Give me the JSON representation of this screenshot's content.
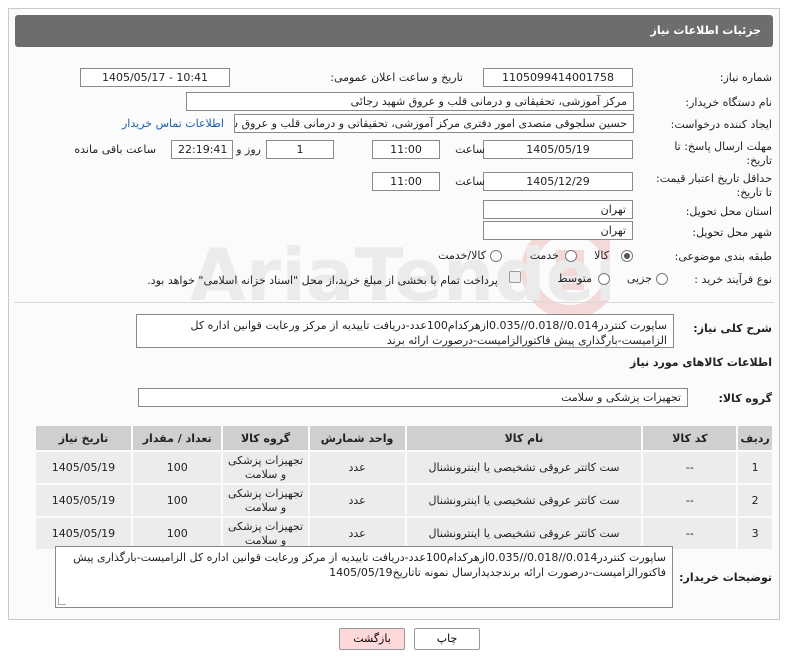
{
  "header": {
    "title": "جزئیات اطلاعات نیاز"
  },
  "form": {
    "need_number_label": "شماره نیاز:",
    "need_number": "1105099414001758",
    "announce_label": "تاریخ و ساعت اعلان عمومی:",
    "announce_value": "1405/05/17 - 10:41",
    "buyer_org_label": "نام دستگاه خریدار:",
    "buyer_org": "مرکز آموزشی، تحقیقاتی و درمانی قلب و عروق شهید رجائی",
    "creator_label": "ایجاد کننده درخواست:",
    "creator": "حسین سلجوقی متصدی امور دفتری مرکز آموزشی، تحقیقاتی و درمانی قلب و عروق شهید رجائی",
    "contact_link": "اطلاعات تماس خریدار",
    "deadline_label": "مهلت ارسال پاسخ: تا تاریخ:",
    "deadline_date": "1405/05/19",
    "time_label": "ساعت",
    "deadline_time": "11:00",
    "days_value": "1",
    "days_label": "روز و",
    "remaining_time": "22:19:41",
    "remaining_label": "ساعت باقی مانده",
    "validity_label": "حداقل تاریخ اعتبار قیمت: تا تاریخ:",
    "validity_date": "1405/12/29",
    "validity_time": "11:00",
    "province_label": "استان محل تحویل:",
    "province": "تهران",
    "city_label": "شهر محل تحویل:",
    "city": "تهران",
    "category_label": "طبقه بندی موضوعی:",
    "category_options": [
      "کالا",
      "خدمت",
      "کالا/خدمت"
    ],
    "purchase_type_label": "نوع فرآیند خرید :",
    "purchase_options": [
      "جزیی",
      "متوسط"
    ],
    "payment_note": "پرداخت تمام یا بخشی از مبلغ خرید،از محل \"اسناد خزانه اسلامی\" خواهد بود.",
    "summary_label": "شرح کلی نیاز:",
    "summary": "ساپورت کنتردر0.014//0.018//0.035ازهرکدام100عدد-دریافت تاییدیه از مرکز ورعایت قوانین اداره کل الزامیست-بارگذاری پیش فاکتورالزامیست-درصورت ارائه برند",
    "goods_info_label": "اطلاعات کالاهای مورد نیاز",
    "goods_group_label": "گروه کالا:",
    "goods_group": "تجهیزات پزشکی و سلامت"
  },
  "table": {
    "headers": [
      "ردیف",
      "کد کالا",
      "نام کالا",
      "واحد شمارش",
      "گروه کالا",
      "تعداد / مقدار",
      "تاریخ نیاز"
    ],
    "rows": [
      {
        "idx": "1",
        "code": "--",
        "name": "ست کاتتر عروقی تشخیصی یا اینترونشنال",
        "unit": "عدد",
        "group": "تجهیزات پزشکی و سلامت",
        "qty": "100",
        "date": "1405/05/19"
      },
      {
        "idx": "2",
        "code": "--",
        "name": "ست کاتتر عروقی تشخیصی یا اینترونشنال",
        "unit": "عدد",
        "group": "تجهیزات پزشکی و سلامت",
        "qty": "100",
        "date": "1405/05/19"
      },
      {
        "idx": "3",
        "code": "--",
        "name": "ست کاتتر عروقی تشخیصی یا اینترونشنال",
        "unit": "عدد",
        "group": "تجهیزات پزشکی و سلامت",
        "qty": "100",
        "date": "1405/05/19"
      }
    ]
  },
  "buyer_notes": {
    "label": "توضیحات خریدار:",
    "text": "ساپورت کنتردر0.014//0.018//0.035ازهرکدام100عدد-دریافت تاییدیه از مرکز ورعایت قوانین اداره کل الزامیست-بارگذاری پیش فاکتورالزامیست-درصورت ارائه برندجدیدارسال نمونه تاتاریخ1405/05/19"
  },
  "buttons": {
    "print": "چاپ",
    "back": "بازگشت"
  },
  "colors": {
    "header_bg": "#6d6d6d",
    "link": "#1a5fb4",
    "back_btn": "#ffd9d9",
    "table_head": "#cfcfcf"
  }
}
